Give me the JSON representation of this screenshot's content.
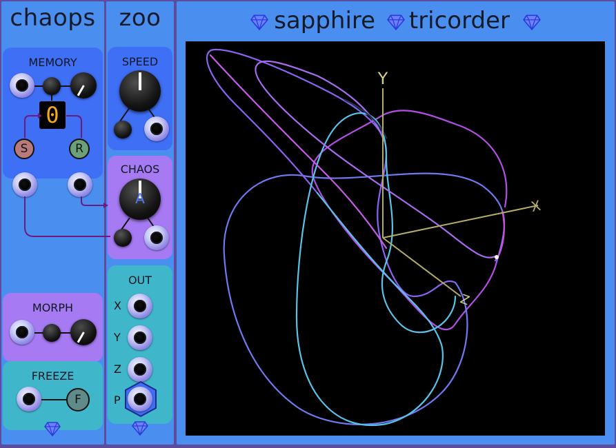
{
  "chaops": {
    "title": "chaops",
    "memory_label": "MEMORY",
    "memory_display": "0",
    "store_button": "S",
    "recall_button": "R",
    "morph_label": "MORPH",
    "freeze_label": "FREEZE",
    "freeze_button": "F"
  },
  "zoo": {
    "title": "zoo",
    "speed_label": "SPEED",
    "chaos_label": "CHAOS",
    "chaos_knob_letter": "A",
    "out_label": "OUT",
    "out_x": "X",
    "out_y": "Y",
    "out_z": "Z",
    "out_p": "P"
  },
  "tricorder": {
    "title_word1": "sapphire",
    "title_word2": "tricorder",
    "axis_x": "X",
    "axis_y": "Y",
    "axis_z": "Z"
  },
  "colors": {
    "panel": "#4a8ff0",
    "rail": "#5d4b9c",
    "memory_section": "#3f6ff5",
    "chaos_section": "#a57af2",
    "out_section": "#3fb6c9",
    "display_digit": "#f6a91a",
    "accent_wire": "#6b1a80"
  }
}
